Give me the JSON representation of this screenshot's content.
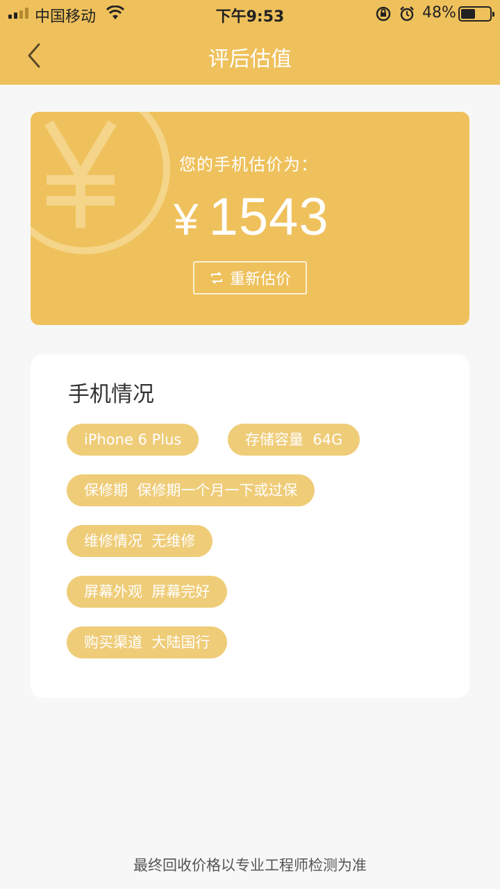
{
  "status_bar": {
    "carrier": "中国移动",
    "time": "下午9:53",
    "battery_pct": "48%",
    "icons": [
      "signal-icon",
      "wifi-icon",
      "rotation-lock-icon",
      "alarm-icon",
      "battery-icon"
    ]
  },
  "header": {
    "title": "评后估值",
    "back_icon": "chevron-left-icon"
  },
  "estimate": {
    "label": "您的手机估价为：",
    "currency": "¥",
    "value": "1543",
    "reestimate_label": "重新估价",
    "reestimate_icon": "refresh-icon"
  },
  "condition": {
    "title": "手机情况",
    "tags": [
      "iPhone 6 Plus",
      "存储容量  64G",
      "保修期  保修期一个月一下或过保",
      "维修情况  无维修",
      "屏幕外观  屏幕完好",
      "购买渠道  大陆国行"
    ]
  },
  "footer": {
    "note": "最终回收价格以专业工程师检测为准"
  },
  "colors": {
    "accent": "#efc15c",
    "tag_bg": "#efcc78",
    "page_bg": "#f7f7f7"
  }
}
